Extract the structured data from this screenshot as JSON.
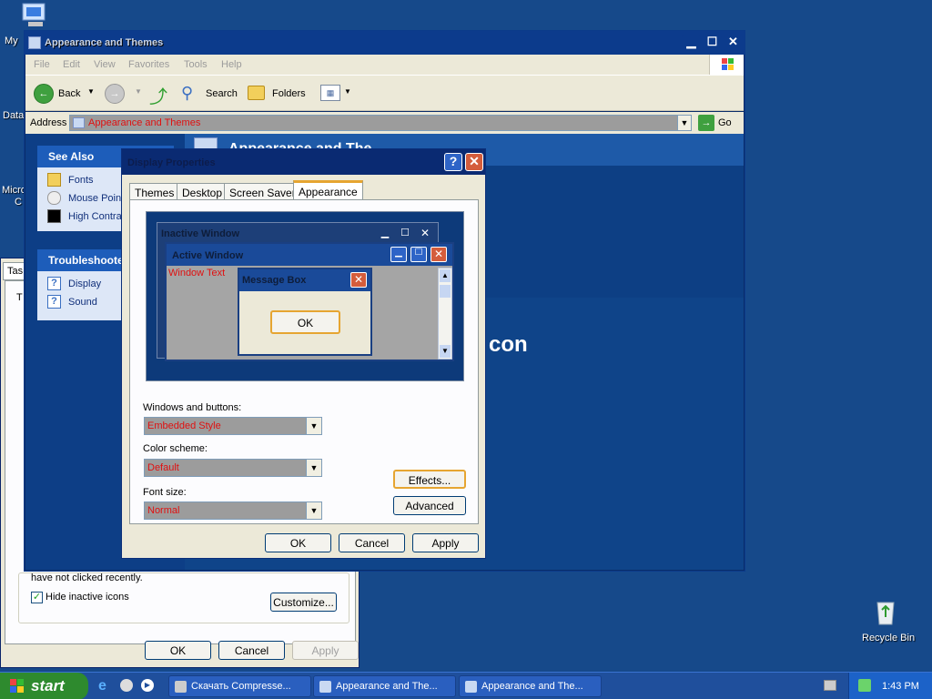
{
  "desktop": {
    "labels": [
      "My",
      "Data",
      "Micro",
      "C"
    ],
    "recycle_bin": "Recycle Bin",
    "big_text": "con"
  },
  "explorer": {
    "title": "Appearance and Themes",
    "menu": [
      "File",
      "Edit",
      "View",
      "Favorites",
      "Tools",
      "Help"
    ],
    "toolbar": {
      "back": "Back",
      "search": "Search",
      "folders": "Folders"
    },
    "address_label": "Address",
    "address_value": "Appearance and Themes",
    "go": "Go",
    "see_also": {
      "title": "See Also",
      "items": [
        "Fonts",
        "Mouse Point",
        "High Contra"
      ]
    },
    "troubleshooters": {
      "title": "Troubleshoote",
      "items": [
        "Display",
        "Sound"
      ]
    },
    "heading_partial": "Appearance and The"
  },
  "taskbar_props": {
    "tab_partial": "Tas",
    "text_partial": "T",
    "hint_text": "have not clicked recently.",
    "hide_inactive": "Hide inactive icons",
    "customize": "Customize...",
    "ok": "OK",
    "cancel": "Cancel",
    "apply": "Apply"
  },
  "display": {
    "title": "Display Properties",
    "tabs": [
      "Themes",
      "Desktop",
      "Screen Saver",
      "Appearance"
    ],
    "active_tab": "Appearance",
    "preview": {
      "inactive": "Inactive Window",
      "active": "Active Window",
      "window_text": "Window Text",
      "message_box": "Message Box",
      "ok": "OK"
    },
    "windows_buttons_label": "Windows and buttons:",
    "windows_buttons_value": "Embedded Style",
    "color_scheme_label": "Color scheme:",
    "color_scheme_value": "Default",
    "font_size_label": "Font size:",
    "font_size_value": "Normal",
    "effects": "Effects...",
    "advanced": "Advanced",
    "ok": "OK",
    "cancel": "Cancel",
    "apply": "Apply"
  },
  "taskbar": {
    "start": "start",
    "tasks": [
      "Скачать Compresse...",
      "Appearance and The...",
      "Appearance and The..."
    ],
    "clock": "1:43 PM"
  }
}
